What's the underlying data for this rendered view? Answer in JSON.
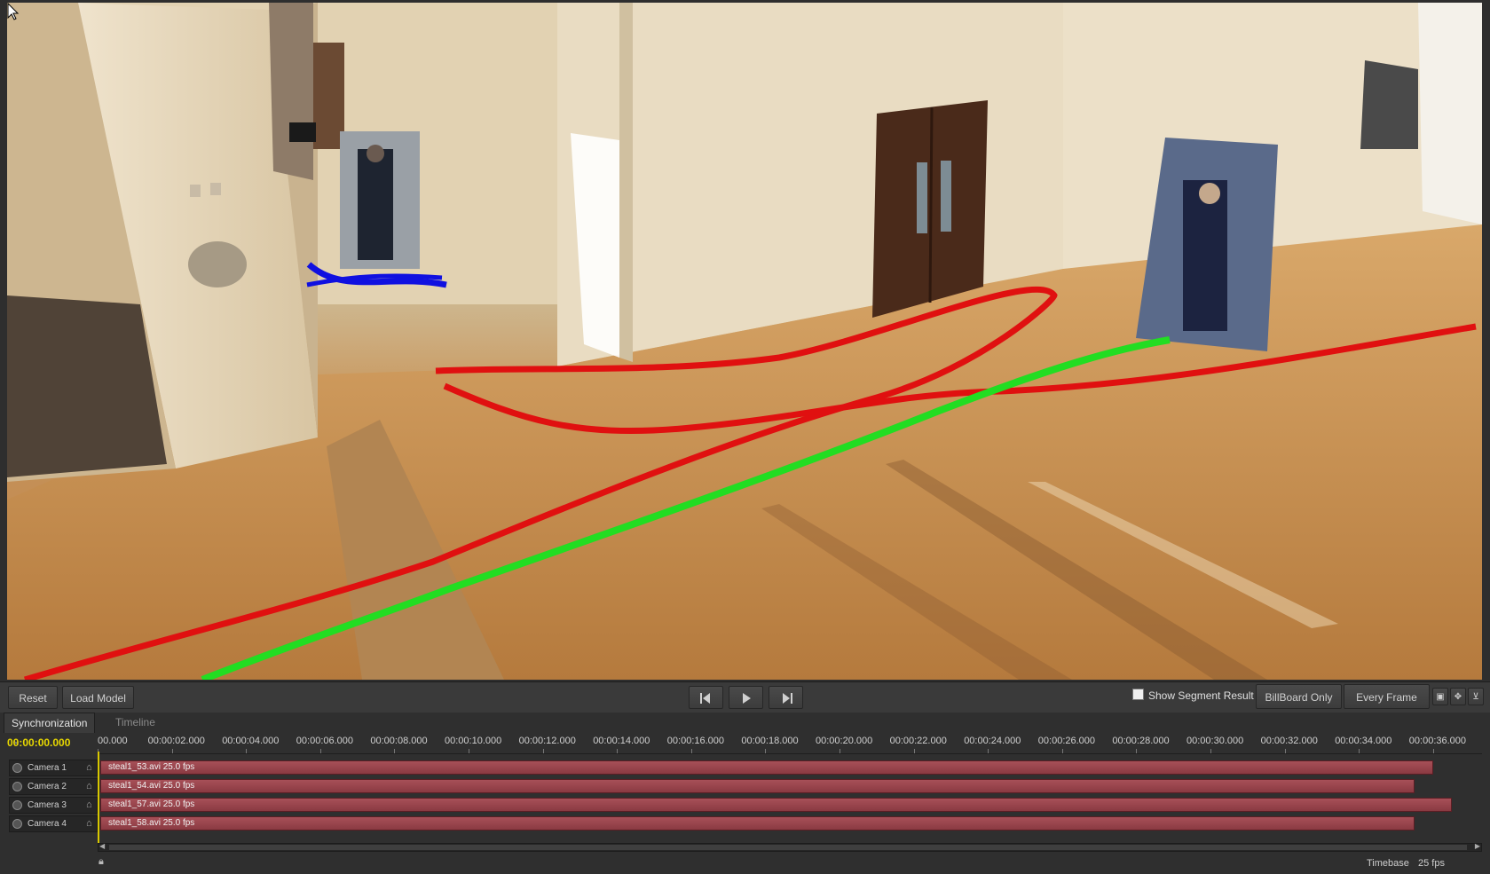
{
  "toolbar": {
    "reset": "Reset",
    "load_model": "Load Model",
    "prev_icon": "step-back-icon",
    "play_icon": "play-icon",
    "next_icon": "step-forward-icon",
    "show_segment": "Show Segment Result",
    "billboard": "BillBoard Only",
    "every_frame": "Every Frame"
  },
  "panel": {
    "tabs": [
      {
        "label": "Synchronization",
        "close": "×"
      },
      {
        "label": "Timeline"
      }
    ],
    "timecode": "00:00:00.000",
    "ruler": [
      "00.000",
      "00:00:02.000",
      "00:00:04.000",
      "00:00:06.000",
      "00:00:08.000",
      "00:00:10.000",
      "00:00:12.000",
      "00:00:14.000",
      "00:00:16.000",
      "00:00:18.000",
      "00:00:20.000",
      "00:00:22.000",
      "00:00:24.000",
      "00:00:26.000",
      "00:00:28.000",
      "00:00:30.000",
      "00:00:32.000",
      "00:00:34.000",
      "00:00:36.000"
    ],
    "tracks": [
      {
        "name": "Camera 1",
        "clip": "steal1_53.avi  25.0 fps",
        "end_seconds": 36.0
      },
      {
        "name": "Camera 2",
        "clip": "steal1_54.avi  25.0 fps",
        "end_seconds": 35.5
      },
      {
        "name": "Camera 3",
        "clip": "steal1_57.avi  25.0 fps",
        "end_seconds": 36.5
      },
      {
        "name": "Camera 4",
        "clip": "steal1_58.avi  25.0 fps",
        "end_seconds": 35.5
      }
    ]
  },
  "status": {
    "timebase_label": "Timebase",
    "timebase_value": "25 fps"
  },
  "colors": {
    "track_red": "#e01010",
    "track_green": "#22dd22",
    "track_blue": "#1010e0",
    "timecode": "#e8d800"
  }
}
